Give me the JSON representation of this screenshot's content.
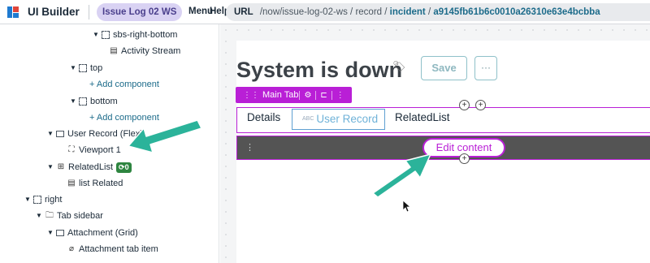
{
  "header": {
    "app_title": "UI Builder",
    "experience_pill": "Issue Log 02 WS",
    "menu_label": "Menu",
    "help_label": "Help",
    "url": {
      "label": "URL",
      "path_prefix": "/now/issue-log-02-ws / record /",
      "table": "incident",
      "separator": "/",
      "sys_id": "a9145fb61b6c0010a26310e63e4bcbba"
    }
  },
  "tree": {
    "items": [
      {
        "label": "sbs-right-bottom",
        "icon": "dashed-box-icon",
        "expanded": true
      },
      {
        "label": "Activity Stream",
        "icon": "list-icon"
      },
      {
        "label": "top",
        "icon": "dashed-box-icon",
        "expanded": true
      },
      {
        "label": "+ Add component",
        "type": "add"
      },
      {
        "label": "bottom",
        "icon": "dashed-box-icon",
        "expanded": true
      },
      {
        "label": "+ Add component",
        "type": "add"
      },
      {
        "label": "User Record (Flex)",
        "icon": "rect-icon",
        "expanded": true
      },
      {
        "label": "Viewport 1",
        "icon": "viewport-icon"
      },
      {
        "label": "RelatedList",
        "icon": "related-list-icon",
        "expanded": true,
        "badge": "0"
      },
      {
        "label": "list Related",
        "icon": "list-icon"
      },
      {
        "label": "right",
        "icon": "dashed-box-icon",
        "expanded": true
      },
      {
        "label": "Tab sidebar",
        "icon": "folder-tab-icon",
        "expanded": true
      },
      {
        "label": "Attachment (Grid)",
        "icon": "rect-icon",
        "expanded": true
      },
      {
        "label": "Attachment tab item",
        "icon": "paperclip-icon"
      }
    ]
  },
  "canvas": {
    "record_title": "System is down",
    "save_label": "Save",
    "more_label": "···",
    "toolbar_label": "Main Tab",
    "tabs": [
      "Details",
      "User Record",
      "RelatedList"
    ],
    "active_tab_prefix": "ABC",
    "edit_content_label": "Edit content"
  },
  "colors": {
    "accent_purple": "#b91fd6",
    "annotation_arrow": "#2bb39a",
    "link_teal": "#1c6b8a",
    "badge_green": "#2e8540"
  }
}
